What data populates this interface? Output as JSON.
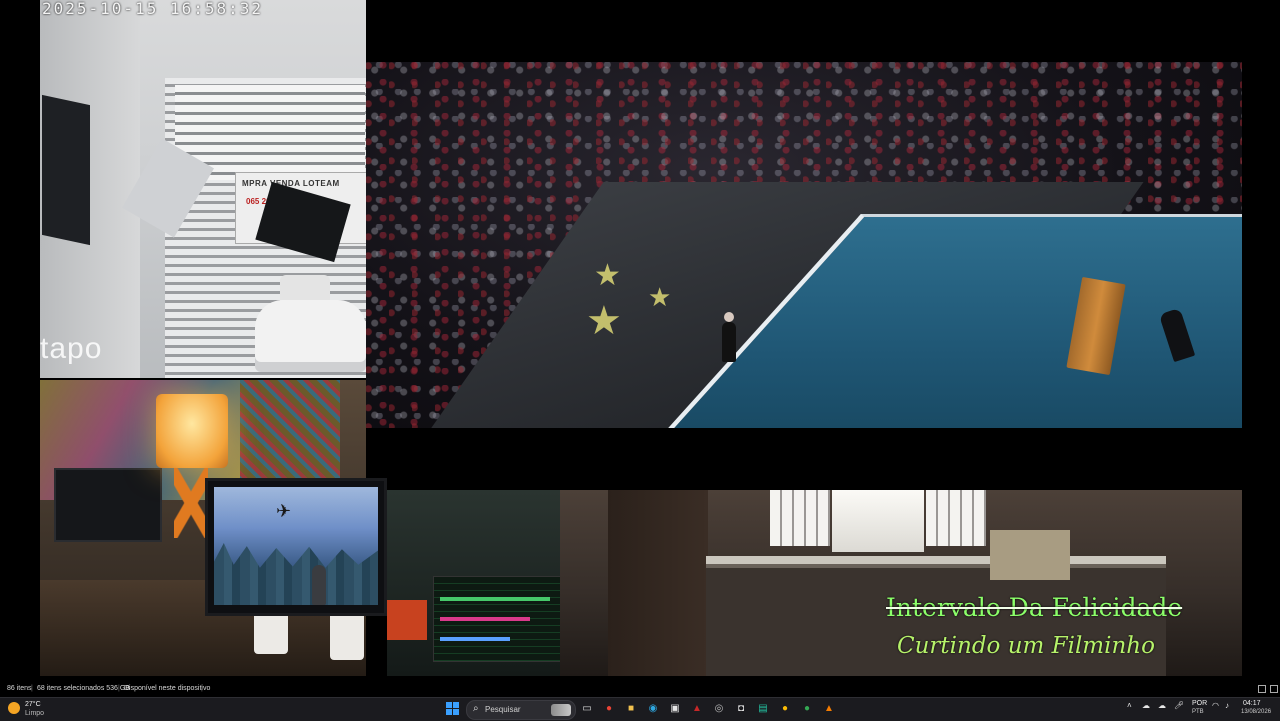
{
  "camera": {
    "timestamp": "2025-10-15  16:58:32",
    "brand": "tapo",
    "sign_line1": "MPRA  VENDA  LOTEAM",
    "sign_line2": "065  2622-8262"
  },
  "film_overlay": {
    "title": "Intervalo Da Felicidade",
    "subtitle": "Curtindo um Filminho"
  },
  "explorer_status": {
    "item_count": "86 itens",
    "selected": "68 itens selecionados  536 GB",
    "availability": "Disponível neste dispositivo"
  },
  "taskbar": {
    "weather": {
      "temp": "27°C",
      "condition": "Limpo",
      "icon": "sun-icon"
    },
    "search_placeholder": "Pesquisar",
    "apps": [
      {
        "name": "task-view-icon",
        "glyph": "▭",
        "color": "#dcdcdc"
      },
      {
        "name": "chrome-icon",
        "glyph": "●",
        "color": "#ea4335"
      },
      {
        "name": "file-explorer-icon",
        "glyph": "■",
        "color": "#f2c14e"
      },
      {
        "name": "edge-icon",
        "glyph": "◉",
        "color": "#2fa7e0"
      },
      {
        "name": "app-icon-1",
        "glyph": "▣",
        "color": "#e6e6e6"
      },
      {
        "name": "app-icon-2",
        "glyph": "▲",
        "color": "#c62828"
      },
      {
        "name": "app-icon-3",
        "glyph": "◎",
        "color": "#bdbdbd"
      },
      {
        "name": "app-icon-4",
        "glyph": "◘",
        "color": "#e0e0e0"
      },
      {
        "name": "app-icon-5",
        "glyph": "▤",
        "color": "#23c4a3"
      },
      {
        "name": "chrome-icon-2",
        "glyph": "●",
        "color": "#fbbc05"
      },
      {
        "name": "chrome-icon-3",
        "glyph": "●",
        "color": "#34a853"
      },
      {
        "name": "vlc-icon",
        "glyph": "▲",
        "color": "#f57c00"
      }
    ],
    "tray_icons": [
      "chevron-up-icon",
      "cloud-icon",
      "onedrive-icon",
      "mic-icon"
    ],
    "language": "POR",
    "layout": "PTB",
    "time": "04:17",
    "date": "13/08/2026"
  }
}
